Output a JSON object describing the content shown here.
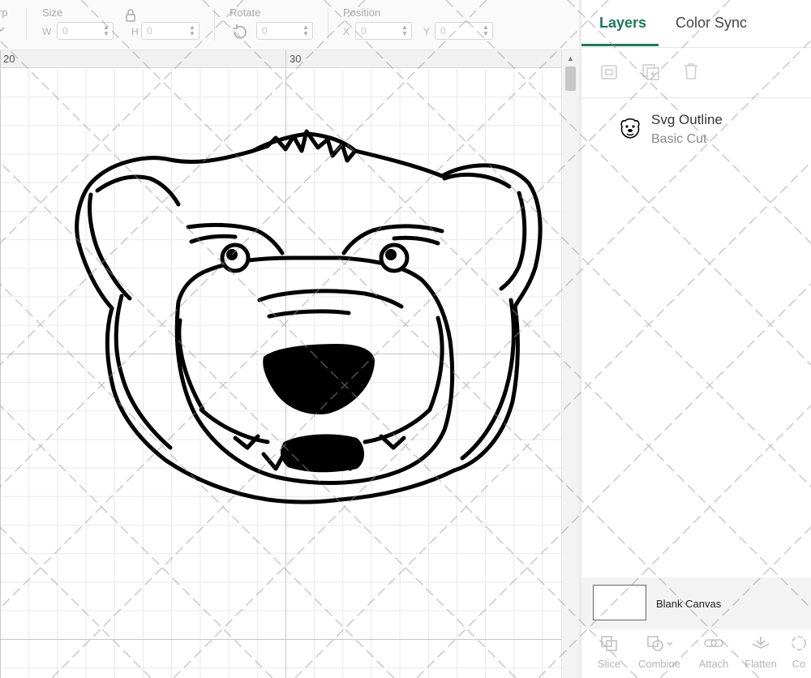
{
  "toolbar": {
    "partial_label": "rp",
    "size_label": "Size",
    "width_letter": "W",
    "width_value": "0",
    "height_letter": "H",
    "height_value": "0",
    "rotate_label": "Rotate",
    "rotate_value": "0",
    "position_label": "Position",
    "x_letter": "X",
    "x_value": "0",
    "y_letter": "Y",
    "y_value": "0"
  },
  "ruler": {
    "marks": [
      "20",
      "30"
    ]
  },
  "panel": {
    "tabs": [
      {
        "label": "Layers",
        "active": true
      },
      {
        "label": "Color Sync",
        "active": false
      }
    ],
    "action_icons": [
      "group-icon",
      "duplicate-icon",
      "delete-icon"
    ],
    "layer": {
      "title": "Svg Outline",
      "subtitle": "Basic Cut",
      "thumb_icon": "bear-face-icon"
    },
    "blank_canvas_label": "Blank Canvas",
    "bottom_actions": [
      {
        "label": "Slice",
        "icon": "slice-icon"
      },
      {
        "label": "Combine",
        "icon": "combine-icon"
      },
      {
        "label": "Attach",
        "icon": "attach-icon"
      },
      {
        "label": "Flatten",
        "icon": "flatten-icon"
      },
      {
        "label": "Co",
        "icon": "contour-icon"
      }
    ]
  },
  "colors": {
    "accent": "#1b7a58",
    "artwork_stroke": "#000000",
    "grid_major": "#c8c8c8",
    "grid_minor": "#e8e8e8"
  }
}
